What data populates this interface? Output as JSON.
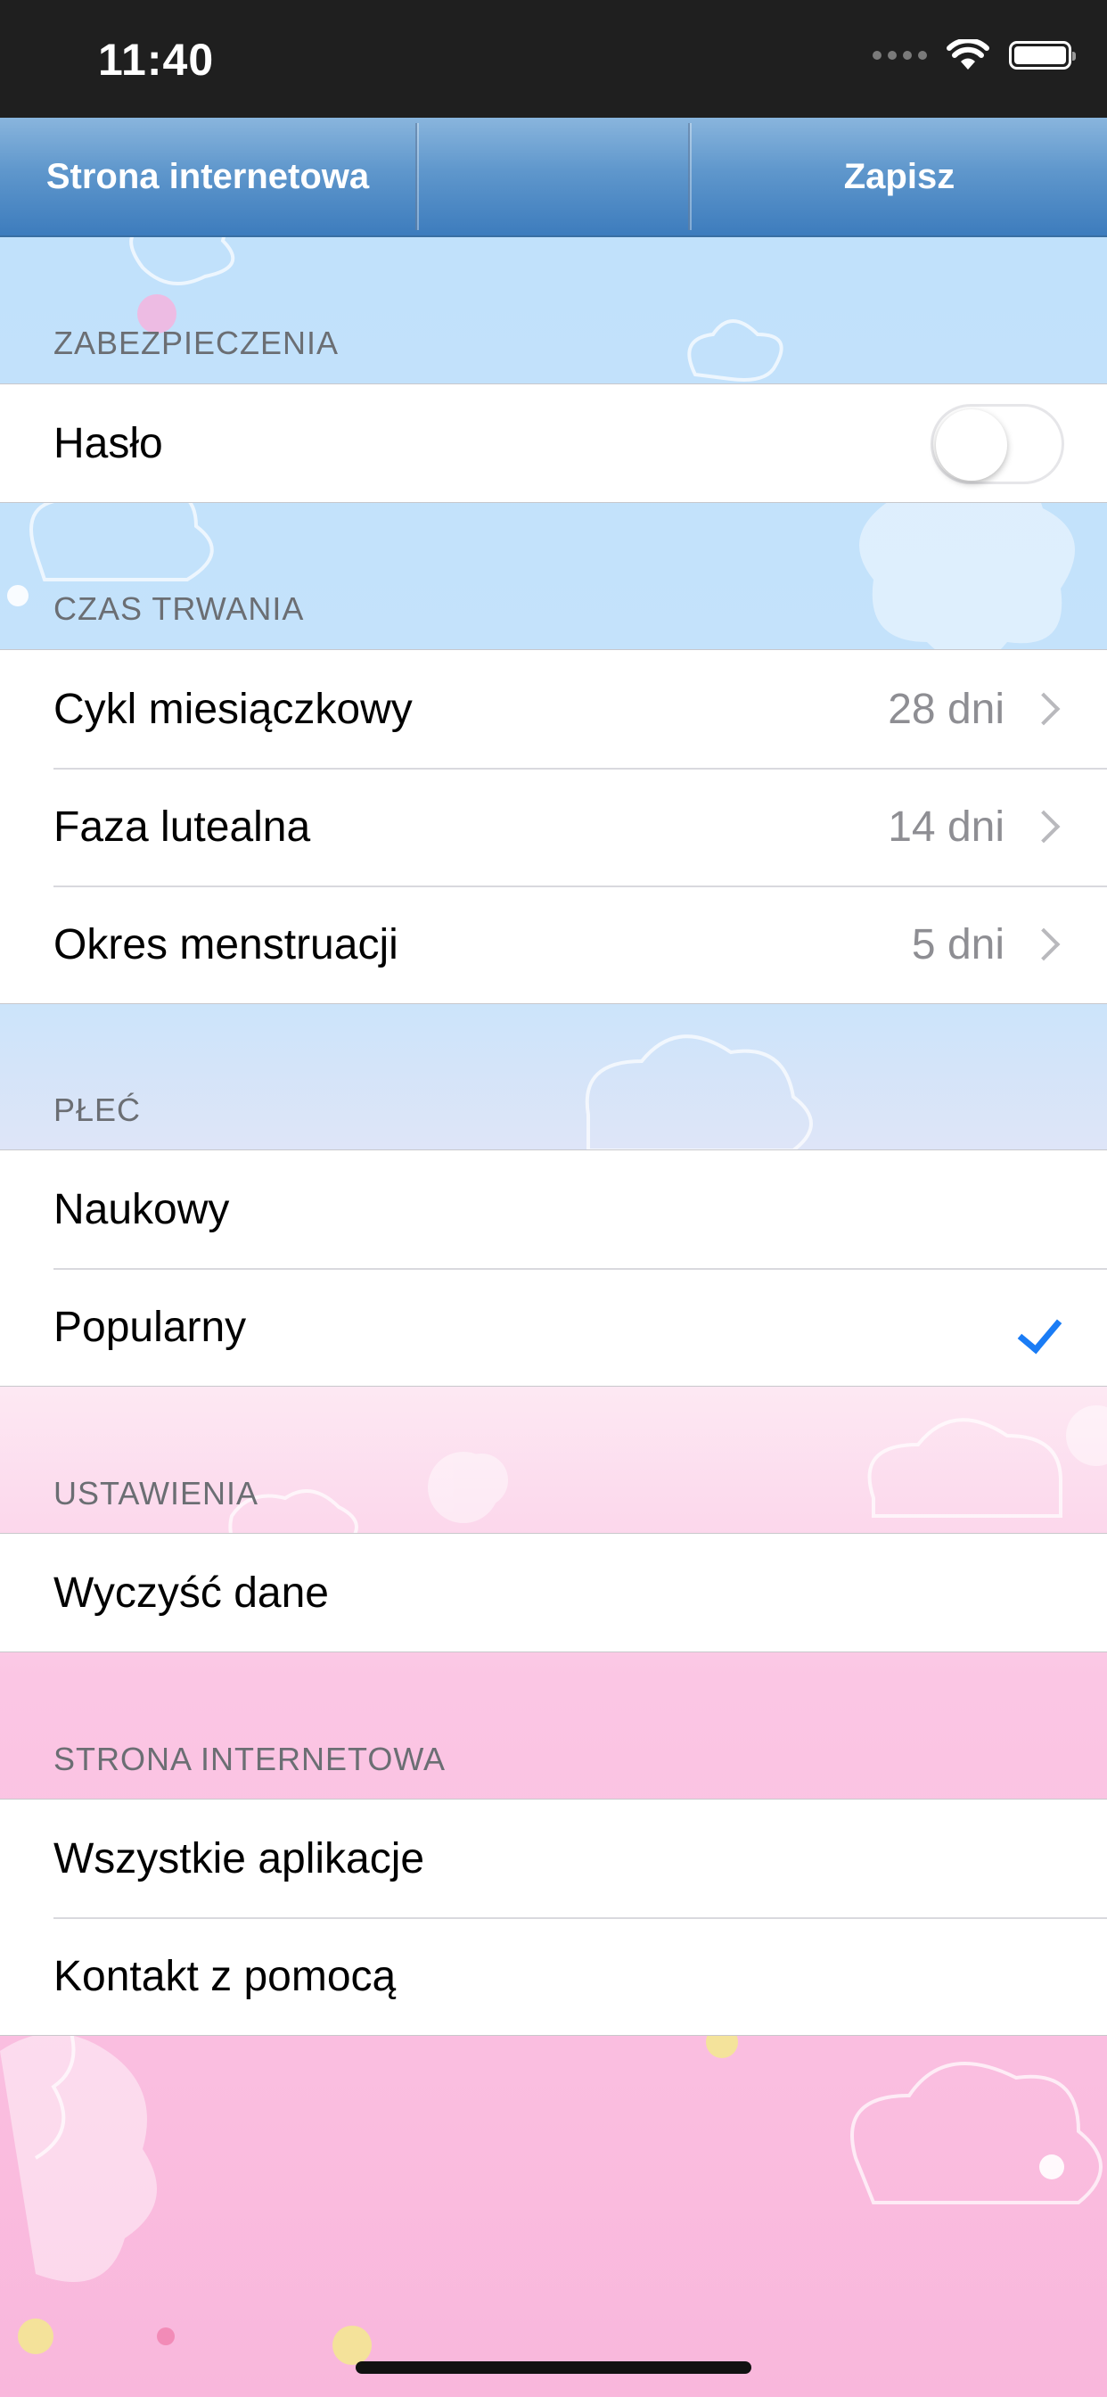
{
  "status_bar": {
    "time": "11:40"
  },
  "toolbar": {
    "left_label": "Strona internetowa",
    "middle_label": "",
    "right_label": "Zapisz"
  },
  "sections": {
    "security": {
      "header": "ZABEZPIECZENIA",
      "password_label": "Hasło",
      "password_enabled": false
    },
    "duration": {
      "header": "CZAS TRWANIA",
      "cycle_label": "Cykl miesiączkowy",
      "cycle_value": "28 dni",
      "luteal_label": "Faza lutealna",
      "luteal_value": "14 dni",
      "period_label": "Okres menstruacji",
      "period_value": "5 dni"
    },
    "gender": {
      "header": "PŁEĆ",
      "scientific_label": "Naukowy",
      "popular_label": "Popularny",
      "selected": "Popularny"
    },
    "settings": {
      "header": "USTAWIENIA",
      "clear_label": "Wyczyść dane"
    },
    "website": {
      "header": "STRONA INTERNETOWA",
      "all_apps_label": "Wszystkie aplikacje",
      "support_label": "Kontakt z pomocą"
    }
  },
  "colors": {
    "accent": "#1a7cf5",
    "toolbar_top": "#89b5dd",
    "toolbar_bottom": "#3d7cbd"
  }
}
